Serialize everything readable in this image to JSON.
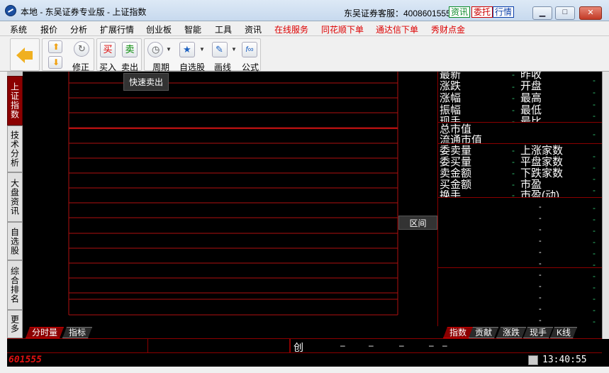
{
  "window": {
    "title": "本地 - 东吴证券专业版 - 上证指数",
    "service_text": "东吴证券客服：4008601555",
    "buttons": {
      "info": "资讯",
      "trust": "委托",
      "quote": "行情"
    }
  },
  "menu": [
    {
      "label": "系统",
      "red": false
    },
    {
      "label": "报价",
      "red": false
    },
    {
      "label": "分析",
      "red": false
    },
    {
      "label": "扩展行情",
      "red": false
    },
    {
      "label": "创业板",
      "red": false
    },
    {
      "label": "智能",
      "red": false
    },
    {
      "label": "工具",
      "red": false
    },
    {
      "label": "资讯",
      "red": false
    },
    {
      "label": "在线服务",
      "red": true
    },
    {
      "label": "同花顺下单",
      "red": true
    },
    {
      "label": "通达信下单",
      "red": true
    },
    {
      "label": "秀财点金",
      "red": true
    }
  ],
  "toolbar": {
    "fix": "修正",
    "buy": "买入",
    "sell": "卖出",
    "period": "周期",
    "watchlist": "自选股",
    "draw": "画线",
    "formula": "公式",
    "buy_glyph": "买",
    "sell_glyph": "卖",
    "formula_glyph": "f∞"
  },
  "tooltip": "快速卖出",
  "left_tabs": [
    "上证指数",
    "技术分析",
    "大盘资讯",
    "自选股",
    "综合排名",
    "更多"
  ],
  "range_button": "区间",
  "right_panel": {
    "rows1": [
      [
        "最新",
        "昨收"
      ],
      [
        "涨跌",
        "开盘"
      ],
      [
        "涨幅",
        "最高"
      ],
      [
        "振幅",
        "最低"
      ],
      [
        "现手",
        "最比"
      ]
    ],
    "rows2": [
      "总市值",
      "流通市值"
    ],
    "rows3": [
      [
        "委卖量",
        "上涨家数"
      ],
      [
        "委买量",
        "平盘家数"
      ],
      [
        "卖金额",
        "下跌家数"
      ],
      [
        "买金额",
        "市盈"
      ],
      [
        "换手",
        "市盈(动)"
      ]
    ],
    "dash": "-"
  },
  "bottom_tabs_left": [
    "分时量",
    "指标"
  ],
  "bottom_tabs_right": [
    "指数",
    "贡献",
    "涨跌",
    "现手",
    "K线"
  ],
  "status": {
    "chuang": "创",
    "dash": "–",
    "stock_code": "601555",
    "time": "13:40:55"
  }
}
